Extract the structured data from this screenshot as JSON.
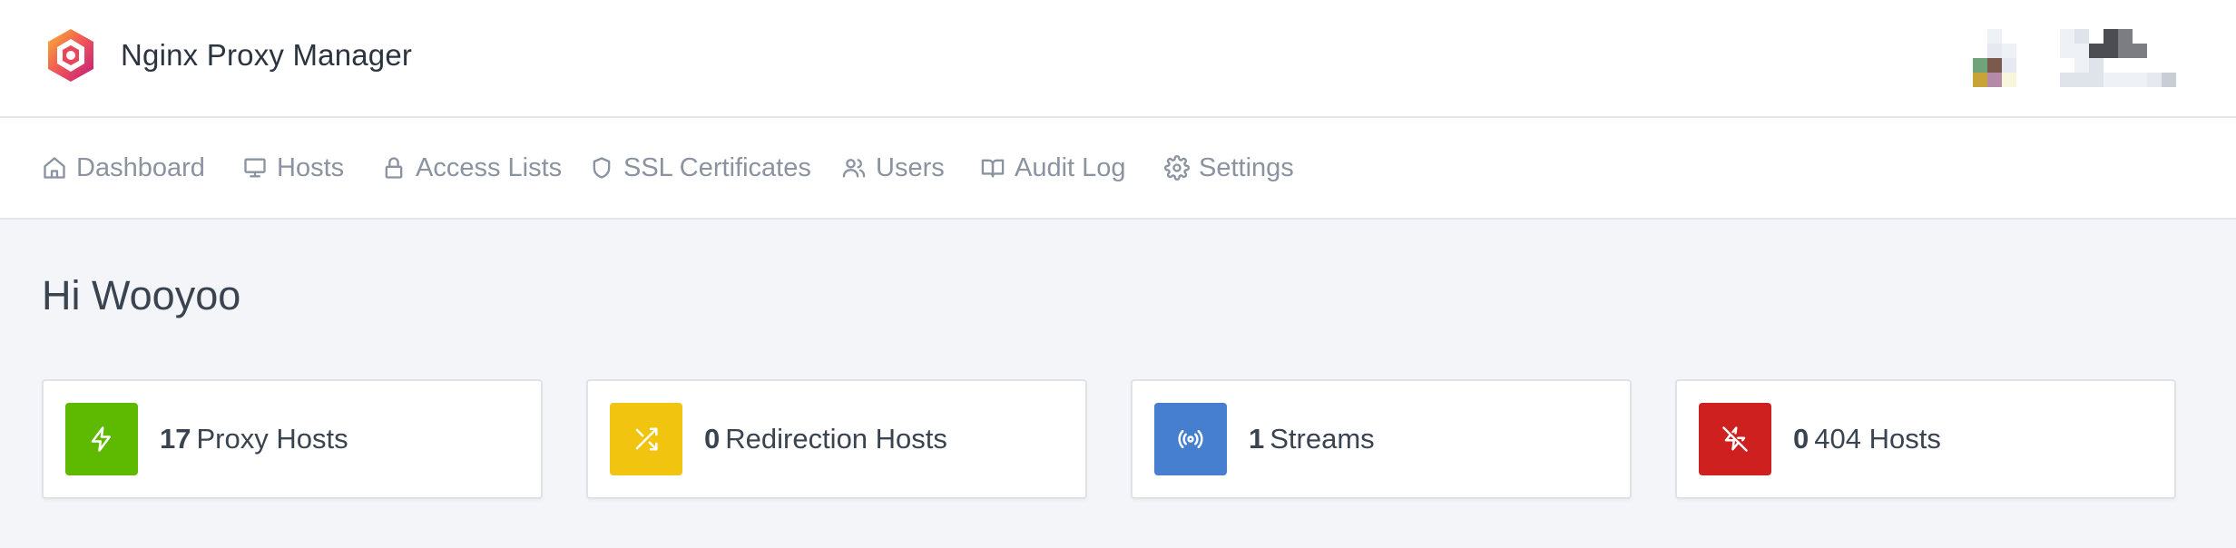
{
  "app": {
    "title": "Nginx Proxy Manager"
  },
  "nav": {
    "items": [
      {
        "label": "Dashboard",
        "icon": "home-icon"
      },
      {
        "label": "Hosts",
        "icon": "monitor-icon"
      },
      {
        "label": "Access Lists",
        "icon": "lock-icon"
      },
      {
        "label": "SSL Certificates",
        "icon": "shield-icon"
      },
      {
        "label": "Users",
        "icon": "users-icon"
      },
      {
        "label": "Audit Log",
        "icon": "book-icon"
      },
      {
        "label": "Settings",
        "icon": "gear-icon"
      }
    ]
  },
  "main": {
    "greeting": "Hi Wooyoo",
    "cards": [
      {
        "count": "17",
        "label": "Proxy Hosts",
        "icon": "zap-icon",
        "color": "#5eba00"
      },
      {
        "count": "0",
        "label": "Redirection Hosts",
        "icon": "shuffle-icon",
        "color": "#f1c40f"
      },
      {
        "count": "1",
        "label": "Streams",
        "icon": "radio-icon",
        "color": "#467fcf"
      },
      {
        "count": "0",
        "label": "404 Hosts",
        "icon": "zap-off-icon",
        "color": "#cd201f"
      }
    ]
  },
  "colors": {
    "page_background": "#f3f5f9",
    "nav_text": "#8a939f"
  }
}
